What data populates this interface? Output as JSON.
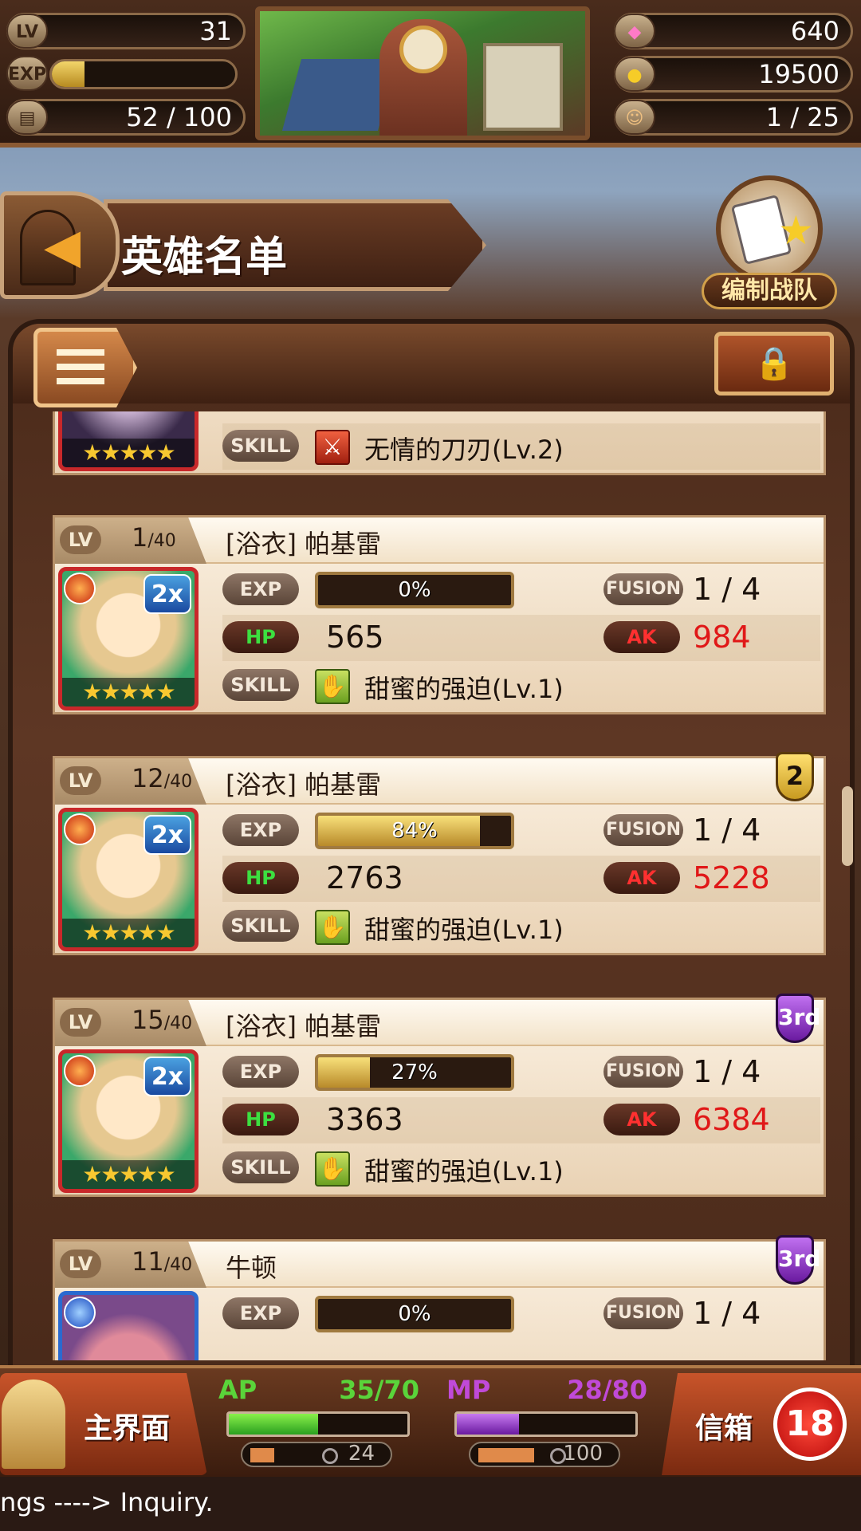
{
  "colors": {
    "hp_label": "#3ce040",
    "ak_value": "#e01818",
    "ap_color": "#5ad43a",
    "mp_color": "#c04ad8"
  },
  "status": {
    "lv_label": "LV",
    "lv_value": "31",
    "exp_label": "EXP",
    "exp_fraction": 0.18,
    "stamina_value": "52 / 100",
    "gems": "640",
    "gold": "19500",
    "friends": "1 / 25"
  },
  "header": {
    "title": "英雄名单",
    "team_button": "编制战队"
  },
  "hero_list": [
    {
      "lv": "",
      "lv_max": "",
      "name": "",
      "skill_label": "SKILL",
      "skill": "无情的刀刃(Lv.2)",
      "portrait": "dark-haired-hero"
    },
    {
      "lv": "1",
      "lv_max": "/40",
      "name": "[浴衣] 帕基雷",
      "exp_label": "EXP",
      "exp_text": "0%",
      "exp_fraction": 0.0,
      "fusion_label": "FUSION",
      "fusion": "1 / 4",
      "hp_label": "HP",
      "hp": "565",
      "ak_label": "AK",
      "ak": "984",
      "skill_label": "SKILL",
      "skill": "甜蜜的强迫(Lv.1)",
      "bonus": "2x",
      "stars": "★★★★★",
      "rank": ""
    },
    {
      "lv": "12",
      "lv_max": "/40",
      "name": "[浴衣] 帕基雷",
      "exp_label": "EXP",
      "exp_text": "84%",
      "exp_fraction": 0.84,
      "fusion_label": "FUSION",
      "fusion": "1 / 4",
      "hp_label": "HP",
      "hp": "2763",
      "ak_label": "AK",
      "ak": "5228",
      "skill_label": "SKILL",
      "skill": "甜蜜的强迫(Lv.1)",
      "bonus": "2x",
      "stars": "★★★★★",
      "rank": "2"
    },
    {
      "lv": "15",
      "lv_max": "/40",
      "name": "[浴衣] 帕基雷",
      "exp_label": "EXP",
      "exp_text": "27%",
      "exp_fraction": 0.27,
      "fusion_label": "FUSION",
      "fusion": "1 / 4",
      "hp_label": "HP",
      "hp": "3363",
      "ak_label": "AK",
      "ak": "6384",
      "skill_label": "SKILL",
      "skill": "甜蜜的强迫(Lv.1)",
      "bonus": "2x",
      "stars": "★★★★★",
      "rank": "3rd"
    },
    {
      "lv": "11",
      "lv_max": "/40",
      "name": "牛顿",
      "exp_label": "EXP",
      "exp_text": "0%",
      "exp_fraction": 0.0,
      "fusion_label": "FUSION",
      "fusion": "1 / 4",
      "rank": "3rd"
    }
  ],
  "bottom": {
    "home_label": "主界面",
    "ap_label": "AP",
    "ap_value": "35/70",
    "ap_fraction": 0.5,
    "ap_timer": "24",
    "mp_label": "MP",
    "mp_value": "28/80",
    "mp_fraction": 0.35,
    "mp_timer": "100",
    "mail_label": "信箱",
    "mail_count": "18"
  },
  "ticker": "ngs ----> Inquiry."
}
